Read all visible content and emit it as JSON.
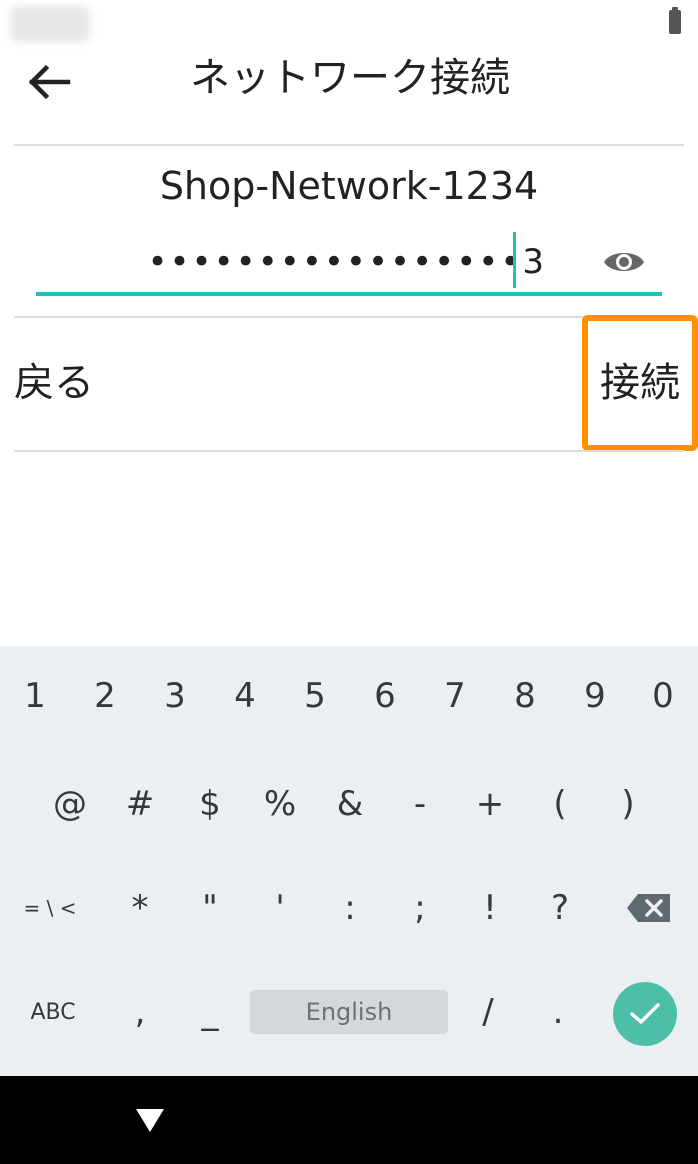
{
  "header": {
    "title": "ネットワーク接続"
  },
  "network": {
    "ssid": "Shop-Network-1234"
  },
  "password": {
    "masked_value": "•••••••••••••••••3"
  },
  "actions": {
    "back_label": "戻る",
    "connect_label": "接続"
  },
  "keyboard": {
    "row1": [
      "1",
      "2",
      "3",
      "4",
      "5",
      "6",
      "7",
      "8",
      "9",
      "0"
    ],
    "row2": [
      "@",
      "#",
      "$",
      "%",
      "&",
      "-",
      "+",
      "(",
      ")"
    ],
    "row3": [
      "= \\ <",
      "*",
      "\"",
      "'",
      ":",
      ";",
      "!",
      "?"
    ],
    "row4": {
      "abc": "ABC",
      "comma": ",",
      "underscore": "_",
      "space": "English",
      "slash": "/",
      "period": "."
    }
  },
  "colors": {
    "accent_teal": "#20c4b6",
    "enter_green": "#4dbfa9",
    "highlight_orange": "#ff9100",
    "keyboard_bg": "#ebeff2"
  },
  "icons": {
    "back": "arrow-left-icon",
    "visibility": "eye-icon",
    "backspace": "backspace-icon",
    "enter": "checkmark-icon",
    "nav_back": "triangle-down-icon"
  }
}
